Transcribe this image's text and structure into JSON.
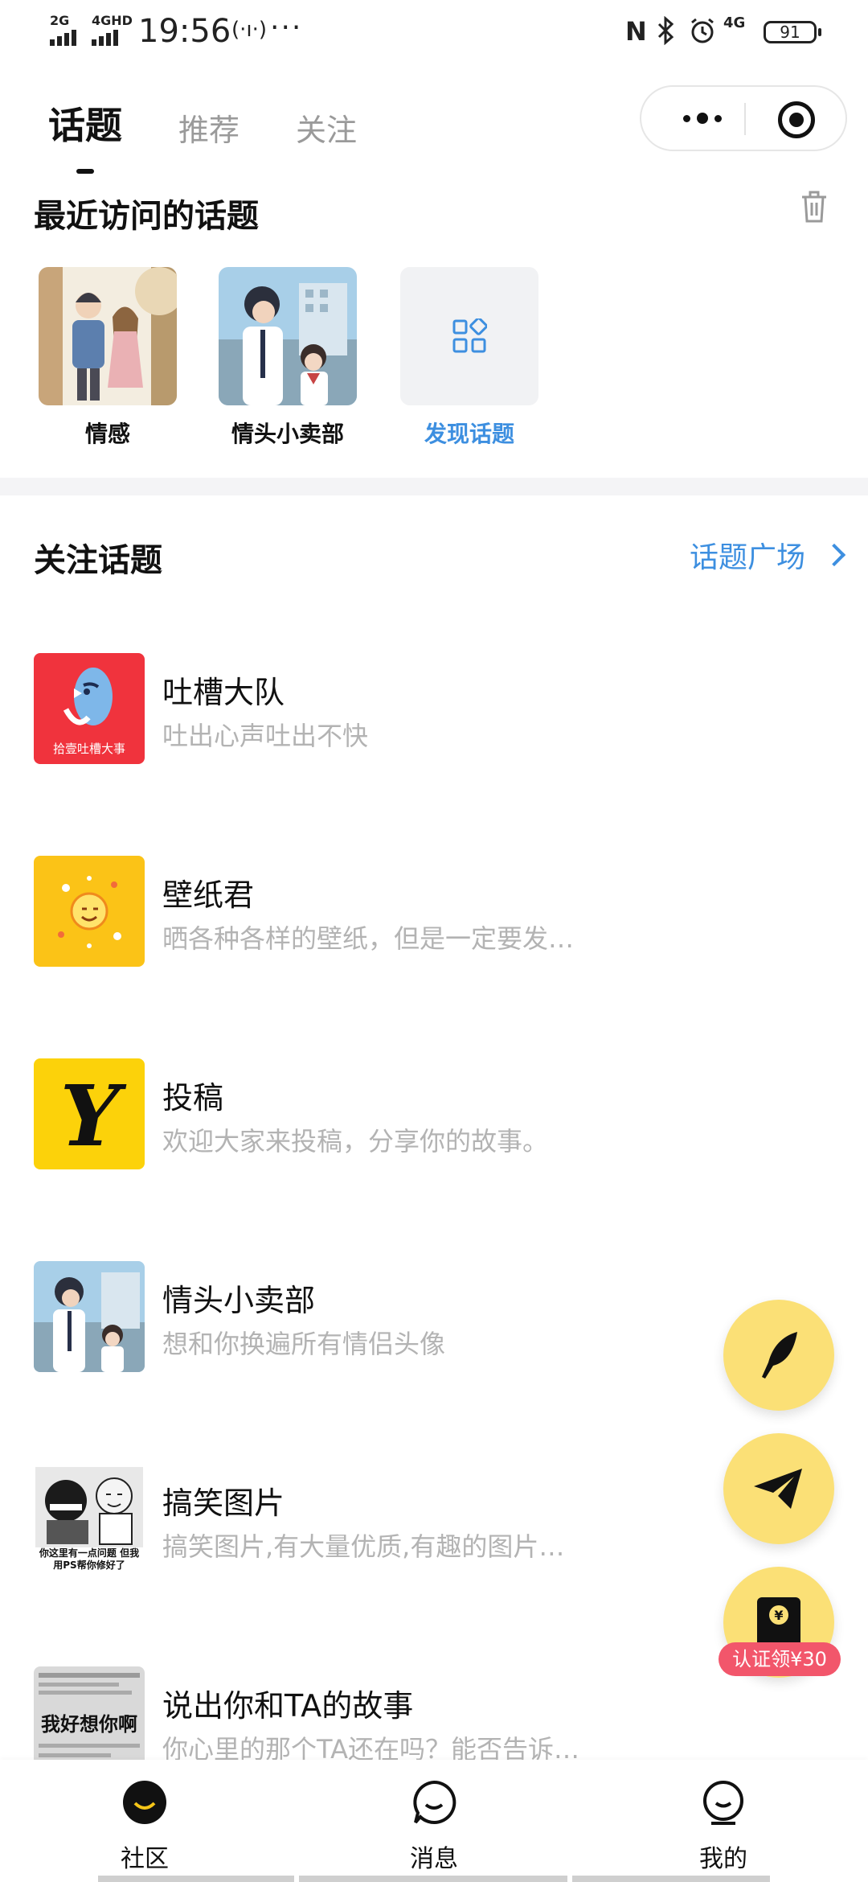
{
  "status_bar": {
    "sim1": "2G",
    "sim2": "4GHD",
    "time": "19:56",
    "hotspot": "(·ı·)",
    "more": "···",
    "net": "4G",
    "battery": "91"
  },
  "top_tabs": [
    {
      "label": "话题",
      "active": true
    },
    {
      "label": "推荐",
      "active": false
    },
    {
      "label": "关注",
      "active": false
    }
  ],
  "recent": {
    "title": "最近访问的话题",
    "items": [
      {
        "label": "情感"
      },
      {
        "label": "情头小卖部"
      },
      {
        "label": "发现话题"
      }
    ]
  },
  "followed": {
    "title": "关注话题",
    "plaza_link": "话题广场",
    "topics": [
      {
        "name": "吐槽大队",
        "desc": "吐出心声吐出不快",
        "avatar_text": "拾壹吐槽大事"
      },
      {
        "name": "壁纸君",
        "desc": "晒各种各样的壁纸，但是一定要发…"
      },
      {
        "name": "投稿",
        "desc": "欢迎大家来投稿，分享你的故事。",
        "avatar_text": "Y"
      },
      {
        "name": "情头小卖部",
        "desc": "想和你换遍所有情侣头像"
      },
      {
        "name": "搞笑图片",
        "desc": "搞笑图片,有大量优质,有趣的图片…",
        "avatar_text": "你这里有一点问题 但我用PS帮你修好了"
      },
      {
        "name": "说出你和TA的故事",
        "desc": "你心里的那个TA还在吗？能否告诉…",
        "avatar_text": "我好想你啊"
      }
    ]
  },
  "fabs": {
    "badge": "认证领¥30"
  },
  "bottom_nav": [
    {
      "label": "社区",
      "active": true
    },
    {
      "label": "消息",
      "active": false
    },
    {
      "label": "我的",
      "active": false
    }
  ],
  "colors": {
    "accent_blue": "#3d8fe0",
    "fab_yellow": "#fbe076",
    "badge_red": "#f2566b"
  }
}
